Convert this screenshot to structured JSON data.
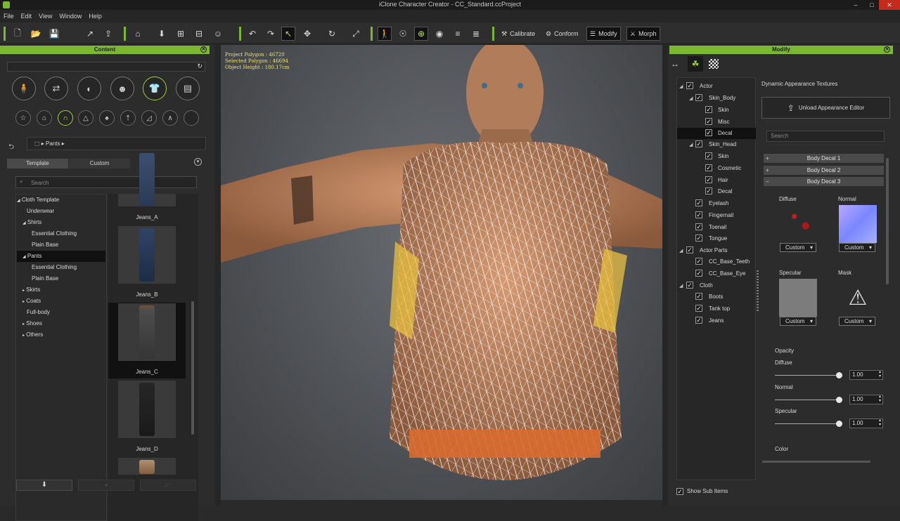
{
  "window": {
    "title": "iClone Character Creator - CC_Standard.ccProject",
    "minimize": "–",
    "maximize": "□",
    "close": "✕"
  },
  "menu": [
    "File",
    "Edit",
    "View",
    "Window",
    "Help"
  ],
  "toolbar": {
    "calibrate": "Calibrate",
    "conform": "Conform",
    "modify": "Modify",
    "morph": "Morph"
  },
  "content": {
    "header": "Content",
    "breadcrumb": "Pants",
    "tabs": {
      "template": "Template",
      "custom": "Custom"
    },
    "search_placeholder": "Search",
    "tree": [
      "Cloth Template",
      "Underwear",
      "Shirts",
      "Essential Clothing",
      "Plain Base",
      "Pants",
      "Essential Clothing",
      "Plain Base",
      "Skirts",
      "Coats",
      "Full-body",
      "Shoes",
      "Others"
    ],
    "items": [
      "Jeans_A",
      "Jeans_B",
      "Jeans_C",
      "Jeans_D"
    ]
  },
  "viewport": {
    "info": [
      "Project Polygon : 46720",
      "Selected Polygon : 46694",
      "Object Height : 180.17cm"
    ]
  },
  "modify": {
    "header": "Modify",
    "tree": [
      "Actor",
      "Skin_Body",
      "Skin",
      "Misc",
      "Decal",
      "Skin_Head",
      "Skin",
      "Cosmetic",
      "Hair",
      "Decal",
      "Eyelash",
      "Fingernail",
      "Toenail",
      "Tongue",
      "Actor Parts",
      "CC_Base_Teeth",
      "CC_Base_Eye",
      "Cloth",
      "Boots",
      "Tank top",
      "Jeans"
    ],
    "show_sub_items": "Show Sub Items",
    "section_title": "Dynamic Appearance Textures",
    "unload_button": "Unload Appearance Editor",
    "search_placeholder": "Search",
    "decals": [
      "Body Decal 1",
      "Body Decal 2",
      "Body Decal 3"
    ],
    "decal_signs": [
      "+",
      "+",
      "–"
    ],
    "textures": {
      "diffuse": "Diffuse",
      "normal": "Normal",
      "specular": "Specular",
      "mask": "Mask",
      "custom": "Custom"
    },
    "opacity": {
      "title": "Opacity",
      "diffuse": "Diffuse",
      "normal": "Normal",
      "specular": "Specular",
      "diffuse_value": "1.00",
      "normal_value": "1.00",
      "specular_value": "1.00"
    },
    "color_label": "Color"
  },
  "colors": {
    "accent": "#7cb82f",
    "panel": "#2c2c2c",
    "viewport_info": "#f0e070"
  }
}
